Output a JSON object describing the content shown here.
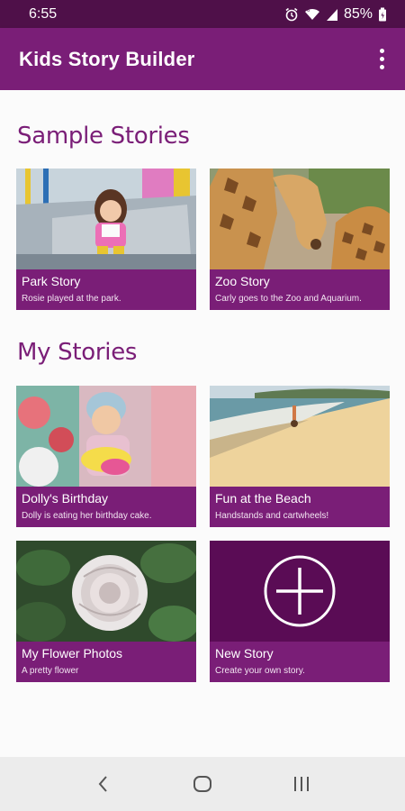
{
  "status_bar": {
    "time": "6:55",
    "battery_percent": "85%",
    "icons": [
      "alarm-icon",
      "wifi-icon",
      "signal-icon",
      "battery-icon"
    ]
  },
  "app_bar": {
    "title": "Kids Story Builder",
    "menu_icon": "more-vert-icon"
  },
  "sections": {
    "sample": {
      "title": "Sample Stories",
      "cards": [
        {
          "title": "Park Story",
          "description": "Rosie played at the park."
        },
        {
          "title": "Zoo Story",
          "description": "Carly goes to the Zoo and Aquarium."
        }
      ]
    },
    "mine": {
      "title": "My Stories",
      "cards": [
        {
          "title": "Dolly's Birthday",
          "description": "Dolly is eating her birthday cake."
        },
        {
          "title": "Fun at the Beach",
          "description": "Handstands and cartwheels!"
        },
        {
          "title": "My Flower Photos",
          "description": "A pretty flower"
        },
        {
          "title": "New Story",
          "description": "Create your own story.",
          "icon": "add-circle-icon"
        }
      ]
    }
  },
  "nav_bar": {
    "buttons": [
      "back-icon",
      "home-icon",
      "recents-icon"
    ]
  },
  "colors": {
    "status_bar": "#4f1049",
    "app_bar": "#7a1e77",
    "accent": "#7a1e77",
    "new_story_bg": "#5a0c55"
  }
}
